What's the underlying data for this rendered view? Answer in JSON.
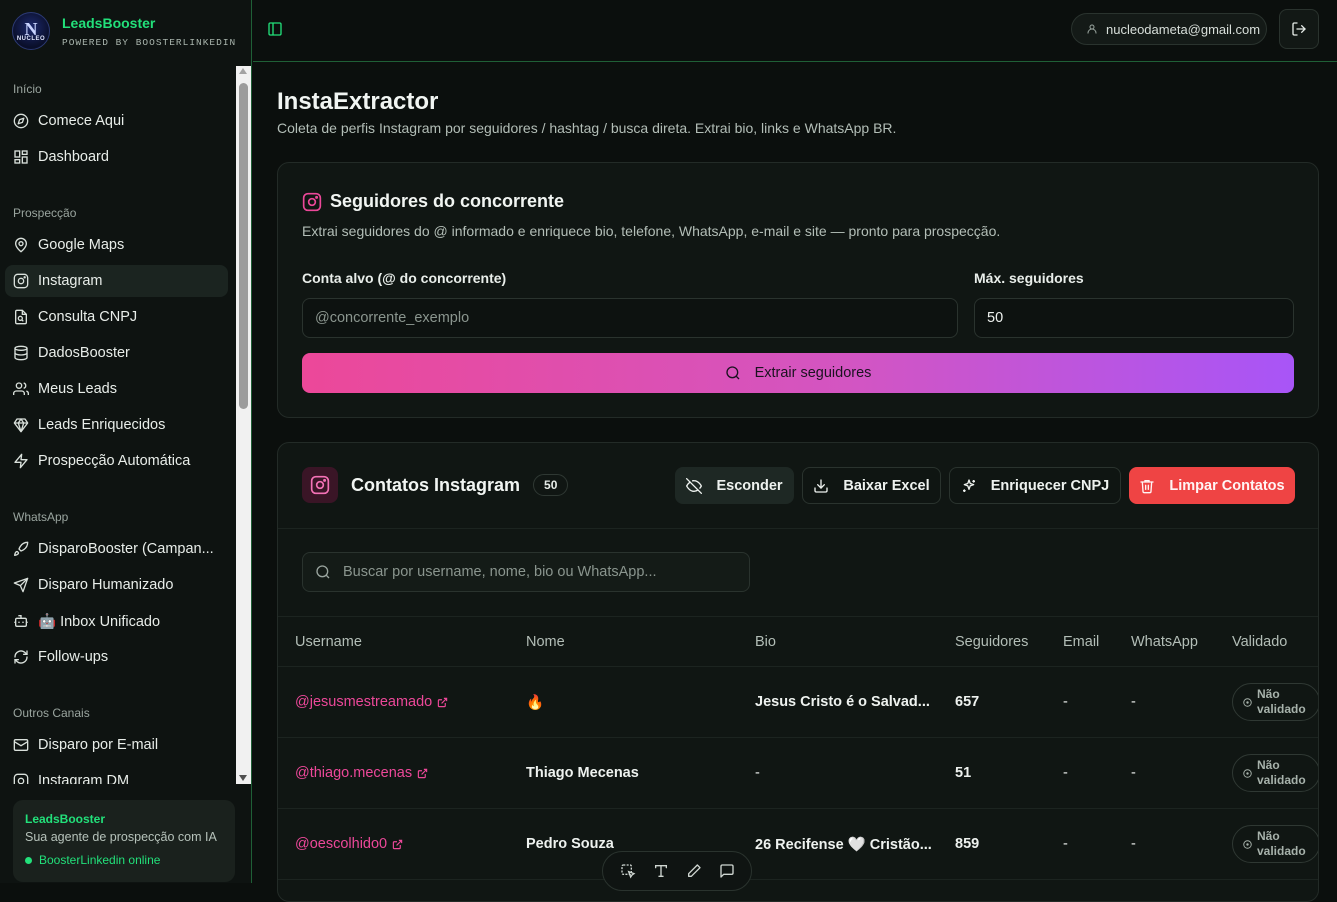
{
  "brand": {
    "name": "LeadsBooster",
    "subtitle": "POWERED BY BOOSTERLINKEDIN",
    "logo_text": "NUCLEO"
  },
  "sidebar": {
    "sections": [
      {
        "label": "Início",
        "items": [
          {
            "label": "Comece Aqui",
            "icon": "compass-icon"
          },
          {
            "label": "Dashboard",
            "icon": "dashboard-icon"
          }
        ]
      },
      {
        "label": "Prospecção",
        "items": [
          {
            "label": "Google Maps",
            "icon": "map-pin-icon"
          },
          {
            "label": "Instagram",
            "icon": "instagram-icon",
            "active": true
          },
          {
            "label": "Consulta CNPJ",
            "icon": "file-search-icon"
          },
          {
            "label": "DadosBooster",
            "icon": "database-icon"
          },
          {
            "label": "Meus Leads",
            "icon": "users-icon"
          },
          {
            "label": "Leads Enriquecidos",
            "icon": "gem-icon"
          },
          {
            "label": "Prospecção Automática",
            "icon": "zap-icon"
          }
        ]
      },
      {
        "label": "WhatsApp",
        "items": [
          {
            "label": "DisparoBooster (Campan...",
            "icon": "rocket-icon"
          },
          {
            "label": "Disparo Humanizado",
            "icon": "send-icon"
          },
          {
            "label": "🤖 Inbox Unificado",
            "icon": "bot-icon"
          },
          {
            "label": "Follow-ups",
            "icon": "refresh-icon"
          }
        ]
      },
      {
        "label": "Outros Canais",
        "items": [
          {
            "label": "Disparo por E-mail",
            "icon": "mail-icon"
          },
          {
            "label": "Instagram DM",
            "icon": "instagram-icon"
          }
        ]
      }
    ],
    "promo": {
      "title": "LeadsBooster",
      "subtitle": "Sua agente de prospecção com IA",
      "status": "BoosterLinkedin online"
    }
  },
  "topbar": {
    "user_email": "nucleodameta@gmail.com"
  },
  "page": {
    "title": "InstaExtractor",
    "subtitle": "Coleta de perfis Instagram por seguidores / hashtag / busca direta. Extrai bio, links e WhatsApp BR."
  },
  "extract_card": {
    "title": "Seguidores do concorrente",
    "description": "Extrai seguidores do @ informado e enriquece bio, telefone, WhatsApp, e-mail e site — pronto para prospecção.",
    "target_label": "Conta alvo (@ do concorrente)",
    "target_placeholder": "@concorrente_exemplo",
    "max_label": "Máx. seguidores",
    "max_value": "50",
    "button_label": "Extrair seguidores"
  },
  "contacts_card": {
    "title": "Contatos Instagram",
    "count": "50",
    "buttons": {
      "hide": "Esconder",
      "excel": "Baixar Excel",
      "enrich": "Enriquecer CNPJ",
      "clear": "Limpar Contatos"
    },
    "search_placeholder": "Buscar por username, nome, bio ou WhatsApp...",
    "columns": [
      "Username",
      "Nome",
      "Bio",
      "Seguidores",
      "Email",
      "WhatsApp",
      "Validado"
    ],
    "rows": [
      {
        "username": "@jesusmestreamado",
        "nome": "🔥",
        "bio": "Jesus Cristo é o Salvad...",
        "seguidores": "657",
        "email": "-",
        "whatsapp": "-",
        "validado": "Não validado"
      },
      {
        "username": "@thiago.mecenas",
        "nome": "Thiago Mecenas",
        "bio": "-",
        "seguidores": "51",
        "email": "-",
        "whatsapp": "-",
        "validado": "Não validado"
      },
      {
        "username": "@oescolhido0",
        "nome": "Pedro Souza",
        "bio": "26 Recifense 🤍 Cristão...",
        "seguidores": "859",
        "email": "-",
        "whatsapp": "-",
        "validado": "Não validado"
      }
    ]
  },
  "colors": {
    "accent_green": "#22e07a",
    "pink": "#ec4899",
    "purple": "#a855f7",
    "danger": "#ef4444"
  }
}
